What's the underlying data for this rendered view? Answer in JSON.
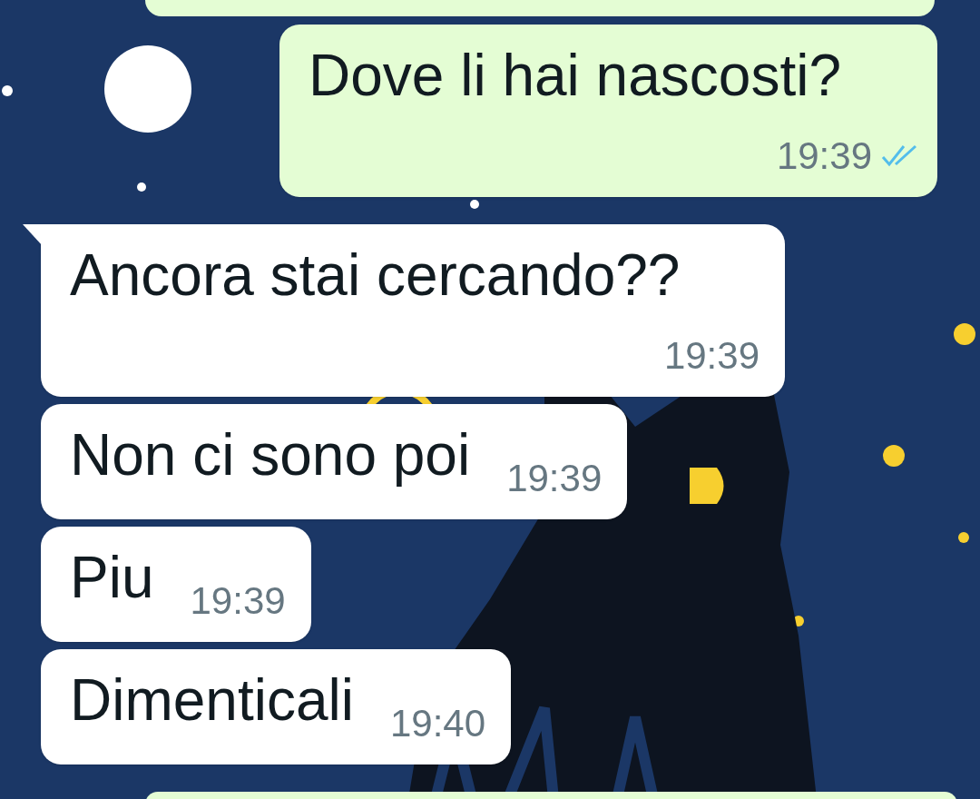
{
  "messages": [
    {
      "kind": "partial-top"
    },
    {
      "kind": "outgoing",
      "text": "Dove li hai nascosti?",
      "time": "19:39",
      "read": true
    },
    {
      "kind": "incoming",
      "text": "Ancora stai cercando??",
      "time": "19:39",
      "tail": true
    },
    {
      "kind": "incoming",
      "text": "Non ci sono poi",
      "time": "19:39",
      "tail": false
    },
    {
      "kind": "incoming",
      "text": "Piu",
      "time": "19:39",
      "tail": false
    },
    {
      "kind": "incoming",
      "text": "Dimenticali",
      "time": "19:40",
      "tail": false
    },
    {
      "kind": "partial-bottom"
    }
  ]
}
